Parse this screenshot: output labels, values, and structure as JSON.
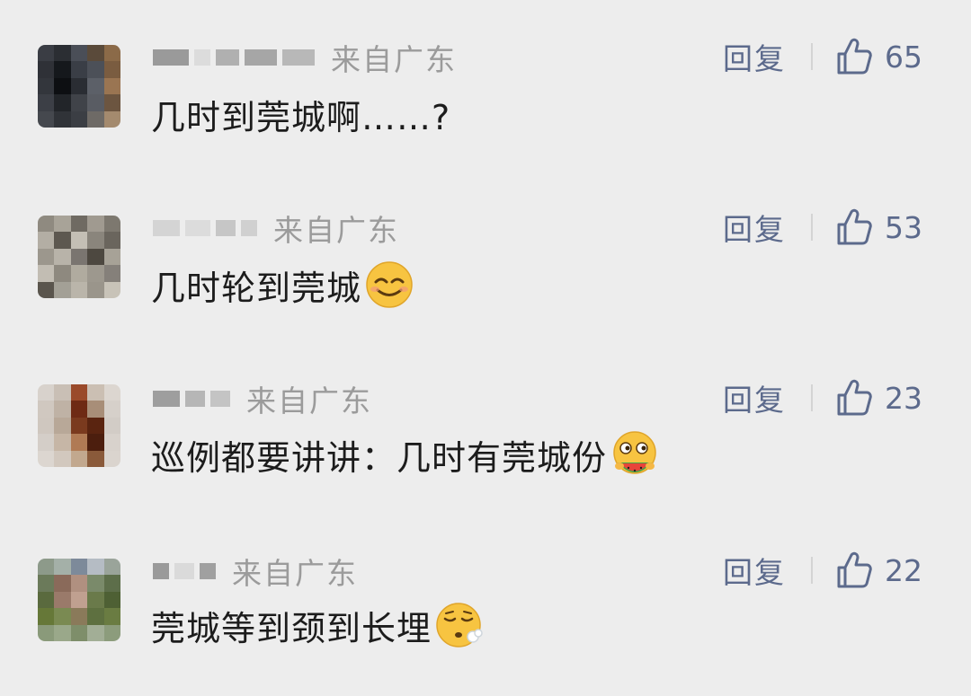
{
  "comments": [
    {
      "location": "来自广东",
      "reply_label": "回复",
      "likes": "65",
      "text": "几时到莞城啊……?",
      "emoji": "none"
    },
    {
      "location": "来自广东",
      "reply_label": "回复",
      "likes": "53",
      "text": "几时轮到莞城",
      "emoji": "smirk-face"
    },
    {
      "location": "来自广东",
      "reply_label": "回复",
      "likes": "23",
      "text": "巡例都要讲讲：几时有莞城份",
      "emoji": "eating-watermelon-face"
    },
    {
      "location": "来自广东",
      "reply_label": "回复",
      "likes": "22",
      "text": "莞城等到颈到长埋",
      "emoji": "sighing-face"
    }
  ],
  "colors": {
    "background": "#ededed",
    "link": "#5c6a8c",
    "muted": "#9b9b9b",
    "text": "#1c1c1c"
  },
  "icons": [
    "thumbs-up-icon"
  ]
}
